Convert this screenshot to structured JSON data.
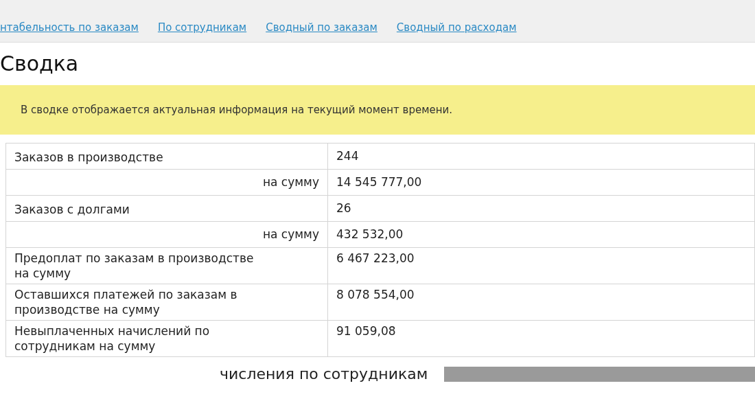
{
  "nav": {
    "links": [
      {
        "label": "нтабельность по заказам"
      },
      {
        "label": "По сотрудникам"
      },
      {
        "label": "Сводный по заказам"
      },
      {
        "label": "Сводный по расходам"
      }
    ]
  },
  "title": "Сводка",
  "notice": "В сводке отображается актуальная информация на текущий момент времени.",
  "summary": {
    "rows": [
      {
        "kind": "group",
        "label": "Заказов в производстве",
        "count": "244",
        "sum_label": "на сумму",
        "sum": "14 545 777,00"
      },
      {
        "kind": "group",
        "label": "Заказов с долгами",
        "count": "26",
        "sum_label": "на сумму",
        "sum": "432 532,00"
      },
      {
        "kind": "single",
        "label": "Предоплат по заказам в производстве на сумму",
        "value": "6 467 223,00"
      },
      {
        "kind": "single",
        "label": "Оставшихся платежей по заказам в производстве на сумму",
        "value": "8 078 554,00"
      },
      {
        "kind": "single",
        "label": "Невыплаченных начислений по сотрудникам на сумму",
        "value": "91 059,08"
      }
    ]
  },
  "next_section": {
    "title": "числения по сотрудникам"
  }
}
